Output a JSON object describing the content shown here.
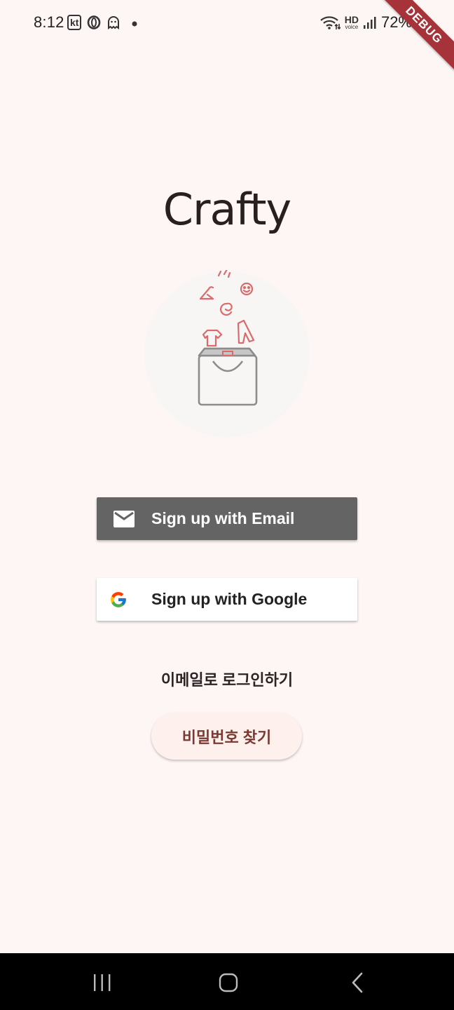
{
  "status_bar": {
    "time": "8:12",
    "carrier": "kt",
    "battery_percent": "72%",
    "icons": [
      "opera-icon",
      "ghost-icon",
      "dot-icon",
      "wifi-icon",
      "hd-voice-icon",
      "signal-icon",
      "battery-icon"
    ],
    "hd_label": "HD",
    "voice_label": "voice"
  },
  "debug_banner": "DEBUG",
  "app": {
    "title": "Crafty"
  },
  "buttons": {
    "email_label": "Sign up with Email",
    "google_label": "Sign up with Google",
    "login_email_label": "이메일로 로그인하기",
    "find_password_label": "비밀번호 찾기"
  },
  "colors": {
    "background": "#fef6f4",
    "email_button": "#646464",
    "google_button": "#ffffff",
    "find_password_text": "#7a3a32",
    "debug_ribbon": "#a6333a",
    "illustration_accent": "#d96b6b"
  },
  "nav_bar": {
    "icons": [
      "recent-apps-icon",
      "home-icon",
      "back-icon"
    ]
  }
}
